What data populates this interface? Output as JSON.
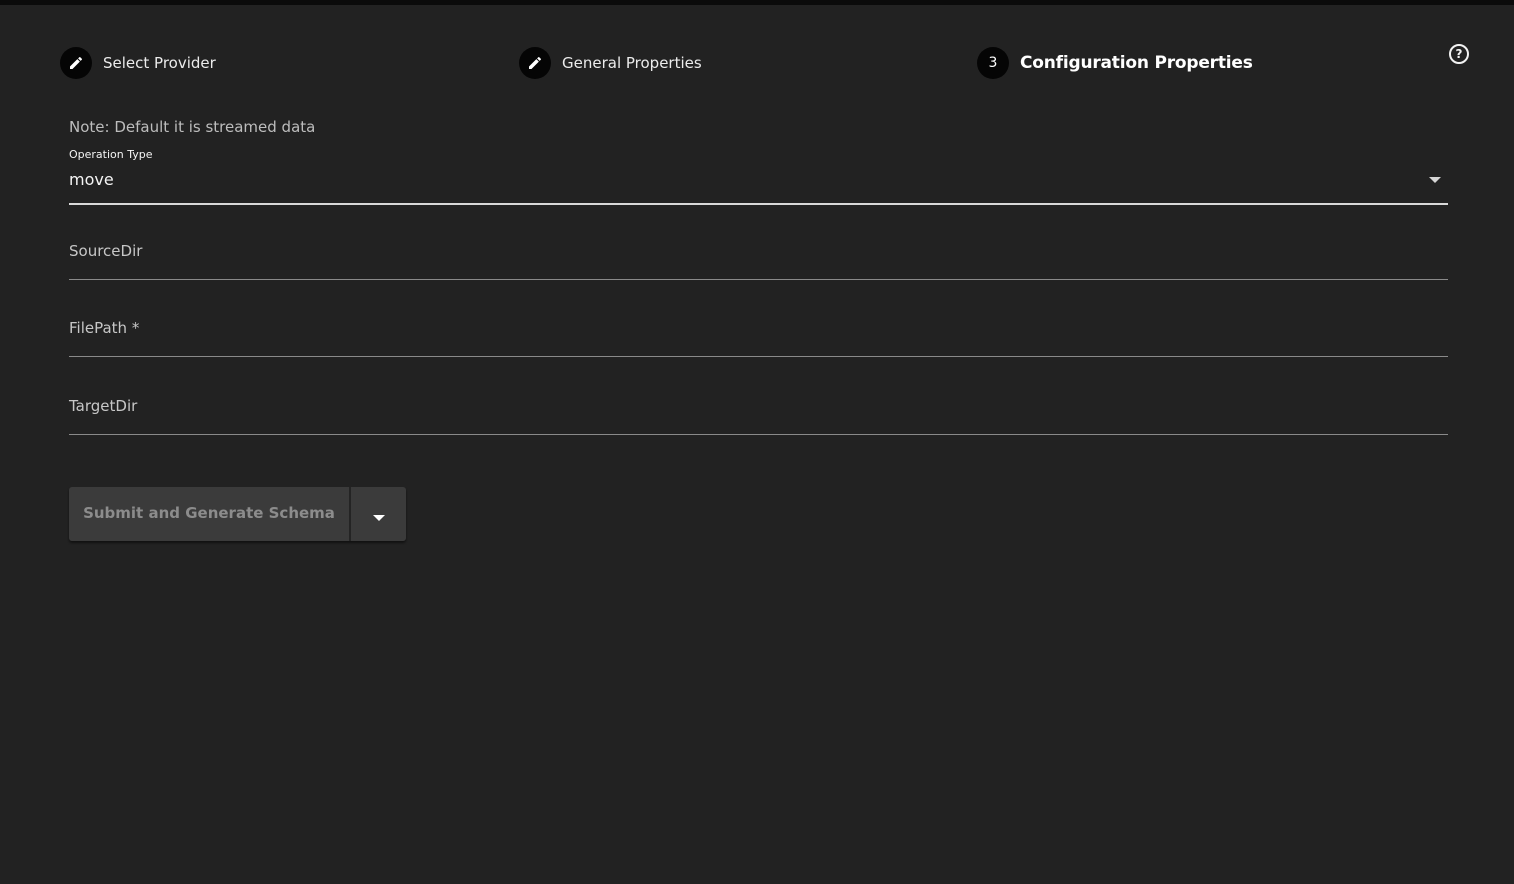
{
  "stepper": {
    "steps": [
      {
        "label": "Select Provider",
        "icon": "pencil-icon",
        "state": "completed"
      },
      {
        "label": "General Properties",
        "icon": "pencil-icon",
        "state": "completed"
      },
      {
        "label": "Configuration Properties",
        "number": "3",
        "state": "active"
      }
    ]
  },
  "help_icon": "help-circle-icon",
  "form": {
    "note": "Note: Default it is streamed data",
    "operation_type": {
      "label": "Operation Type",
      "value": "move"
    },
    "source_dir": {
      "label": "SourceDir",
      "value": ""
    },
    "file_path": {
      "label": "FilePath *",
      "value": ""
    },
    "target_dir": {
      "label": "TargetDir",
      "value": ""
    }
  },
  "actions": {
    "submit_label": "Submit and Generate Schema"
  }
}
